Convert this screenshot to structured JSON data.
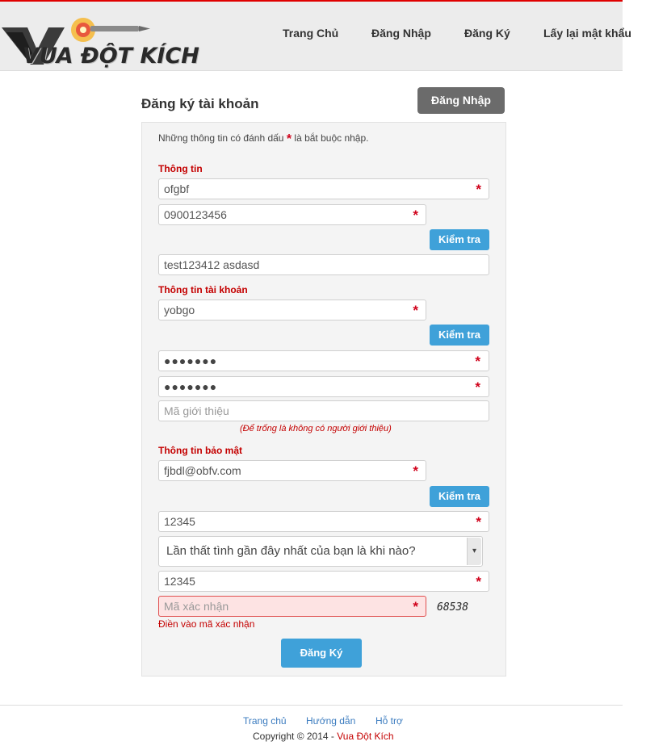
{
  "brand": {
    "logo_text": "VUA ĐỘT KÍCH"
  },
  "nav": {
    "items": [
      "Trang Chủ",
      "Đăng Nhập",
      "Đăng Ký",
      "Lấy lại mật khẩu"
    ]
  },
  "page": {
    "title": "Đăng ký tài khoản",
    "login_button": "Đăng Nhập"
  },
  "form": {
    "required_note_before": "Những thông tin có đánh dấu",
    "required_star": "*",
    "required_note_after": "là bắt buộc nhập.",
    "sections": {
      "info": "Thông tin",
      "account": "Thông tin tài khoản",
      "security": "Thông tin bảo mật"
    },
    "fullname_value": "ofgbf",
    "phone_value": "0900123456",
    "check_label": "Kiểm tra",
    "address_value": "test123412 asdasd",
    "username_value": "yobgo",
    "password_value": "●●●●●●●",
    "confirm_password_value": "●●●●●●●",
    "referral_placeholder": "Mã giới thiệu",
    "referral_hint": "(Để trống là không có người giới thiệu)",
    "email_value": "fjbdl@obfv.com",
    "pin_value": "12345",
    "security_question_selected": "Lần thất tình gần đây nhất của bạn là khi nào?",
    "security_answer_value": "12345",
    "captcha_placeholder": "Mã xác nhận",
    "captcha_image_text": "68538",
    "captcha_error": "Điền vào mã xác nhận",
    "submit_label": "Đăng Ký"
  },
  "footer": {
    "links": [
      "Trang chủ",
      "Hướng dẫn",
      "Hỗ trợ"
    ],
    "copyright_prefix": "Copyright © 2014 - ",
    "copyright_brand": "Vua Đột Kích"
  },
  "colors": {
    "accent_red": "#d0021b",
    "button_blue": "#3fa1d9",
    "login_gray": "#6b6b6b",
    "header_border": "#e00000"
  }
}
